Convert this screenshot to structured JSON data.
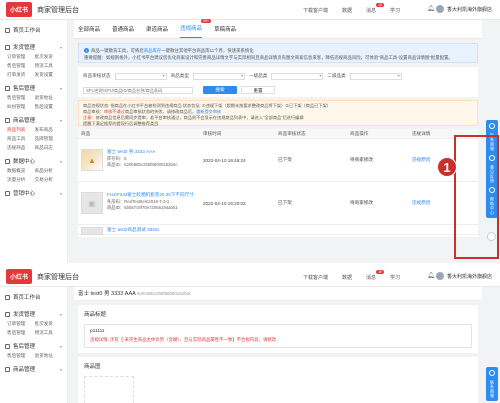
{
  "app": {
    "logo": "小红书",
    "title": "商家管理后台"
  },
  "topbar": {
    "links": [
      "下载客户端",
      "数据",
      "消息",
      "学习"
    ],
    "badge": "19",
    "username": "香大利凯海外旗舰店"
  },
  "sidebar": {
    "home": "首页工作台",
    "groups": [
      {
        "name": "发货管理",
        "items": [
          "订单管理",
          "批次发货",
          "售后管理",
          "物流工具",
          "打单发货",
          "发货设置"
        ]
      },
      {
        "name": "售后管理",
        "items": [
          "售后管理",
          "退货地址",
          "纠纷管理",
          "售后设置"
        ]
      },
      {
        "name": "商品管理",
        "items": [
          "商品列表",
          "发布商品",
          "商品工具",
          "品牌管理",
          "违规商品",
          "商品日志"
        ]
      },
      {
        "name": "数据中心",
        "items": [
          "数据概览",
          "商品分析",
          "流量分析",
          "交易分析"
        ]
      },
      {
        "name": "营销中心",
        "items": []
      }
    ],
    "active_item": "商品列表"
  },
  "tabs": {
    "items": [
      "全部商品",
      "普通商品",
      "渠道商品",
      "违规商品",
      "草稿商品"
    ],
    "active": "违规商品",
    "badge": "99+"
  },
  "notice": {
    "line1_prefix": "商品一键散货工具，可将您",
    "line1_link": "商品库存",
    "line1_suffix": "一键散往其他平台商品库11个月，快速来系统化",
    "line2": "重要提醒：如规则格外，小红书平台建议您优化商家设计和完善商品详情文字与实际相同且商品详情页有图文商家信息来客，降低违规商品风险。可体验“商品工具-设置商品详情图”批量配置。"
  },
  "filters": {
    "row1": {
      "audit_label": "商品审核状态",
      "type_label": "商品类型",
      "cat1_label": "一级品类",
      "cat2_label": "二级品类"
    },
    "row2": {
      "search_placeholder": "SPU名称/SPU/商品ID/商品名称/商品条码",
      "search_button": "搜索",
      "reset_button": "重置"
    }
  },
  "warning": {
    "line1": "商品违规状态: 指商品在小红书平台被检测到违规商品 状态包括: ①违规下架（超期未按要求整改商品将下架）②已下架（商品已下架）",
    "line2_label": "商品审核：",
    "line2_red": "审核不通过",
    "line2_text": "商品审核状态的失败，请修改商品后，",
    "line2_blue": "重新提交审核",
    "line3_label": "注意：",
    "line3_text": "修改商品信息后需同步提审，若平台审核通过，商品则不会显示在违规商品列表中，请进入“全部商品”后进行编辑",
    "line4": "提醒下满足推荐的提现行后调整推荐类目"
  },
  "table": {
    "columns": [
      "商品",
      "审核时间",
      "商品审核状态",
      "商品操作",
      "违规详情"
    ],
    "rows": [
      {
        "store": "香大利凯海外旗舰店",
        "name": "富士 test0 男 3333 AAA",
        "inventory": "库存码：6",
        "id": "商品ID：620b98bc255f86000162b0c",
        "time": "2022-04-10 16:46:24",
        "status": "已下架",
        "action": "待商家修改",
        "detail": "违规原因"
      },
      {
        "store": "香大利凯海外旗舰店",
        "name": "FUJIFILM富士胶相机套装20 30下不同尺寸",
        "inventory": "条形码：RedTestItem2018-7-2-1",
        "id": "商品ID：5b557c8f70e72056194ab51",
        "time": "2022-04-10 16:20:02",
        "status": "已下架",
        "action": "待商家修改",
        "detail": "违规原因"
      },
      {
        "store": "",
        "name": "富士 test2商品测试 333sx",
        "inventory": "",
        "id": "",
        "time": "",
        "status": "",
        "action": "",
        "detail": ""
      }
    ]
  },
  "annotation": {
    "step": "1"
  },
  "rightbar": {
    "items": [
      "联系商服",
      "意见反馈",
      "帮助中心"
    ]
  },
  "detail": {
    "title": "富士 test0 男 3333 AAA",
    "sku": "620c98bc255f86000162b0c",
    "section1_title": "商品标题",
    "field_value": "p11111",
    "field_error": "违规详情: 涉及【-未完生商品主体优势（含糊）、且与实际商品属性不一致】不合规内容，请修改",
    "section2_title": "商品图"
  },
  "colors": {
    "brand_red": "#e4393c",
    "accent_blue": "#2e8cf0",
    "highlight": "#c9302c"
  }
}
